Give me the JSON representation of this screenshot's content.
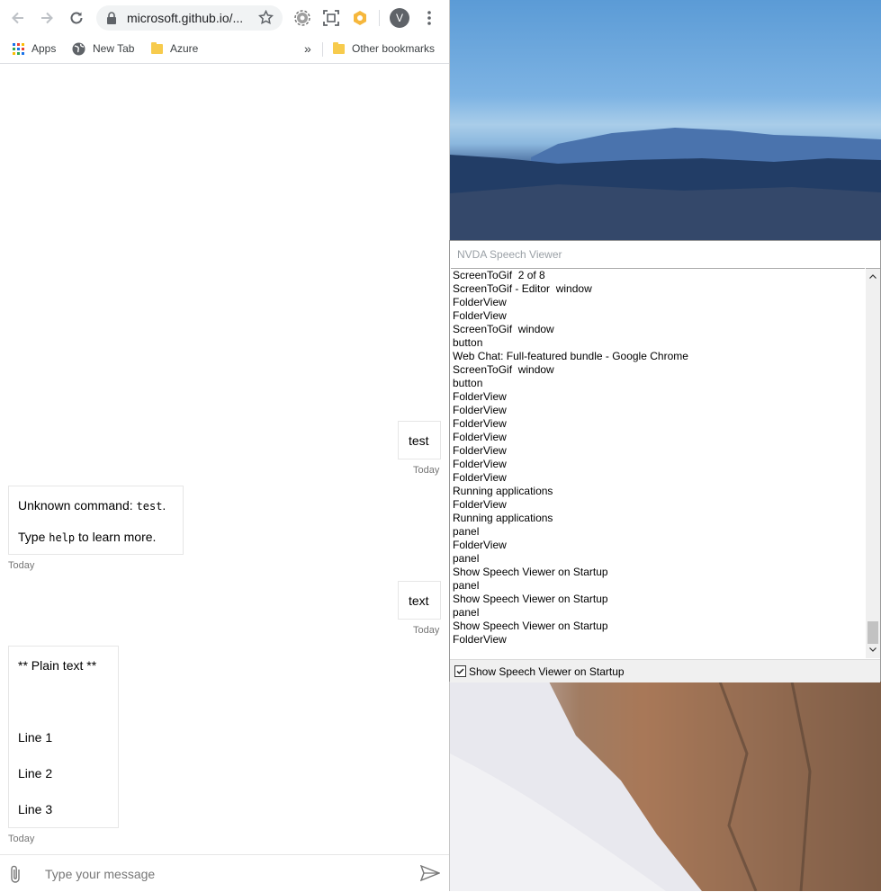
{
  "browser": {
    "url": "microsoft.github.io/...",
    "profile_initial": "V",
    "bookmarks": {
      "apps": "Apps",
      "new_tab": "New Tab",
      "azure": "Azure",
      "more": "»",
      "other": "Other bookmarks"
    }
  },
  "chat": {
    "messages": [
      {
        "from": "user",
        "text": "test",
        "timestamp": "Today"
      },
      {
        "from": "bot",
        "line1_pre": "Unknown command: ",
        "line1_code": "test",
        "line1_post": ".",
        "line2_pre": "Type ",
        "line2_code": "help",
        "line2_post": " to learn more.",
        "timestamp": "Today"
      },
      {
        "from": "user",
        "text": "text",
        "timestamp": "Today"
      },
      {
        "from": "bot",
        "lines": [
          "** Plain text **",
          "Line 1",
          "Line 2",
          "Line 3"
        ],
        "timestamp": "Today"
      }
    ],
    "input_placeholder": "Type your message"
  },
  "nvda": {
    "title": "NVDA Speech Viewer",
    "lines": [
      "ScreenToGif  2 of 8",
      "ScreenToGif - Editor  window",
      "FolderView",
      "FolderView",
      "ScreenToGif  window",
      "button",
      "Web Chat: Full-featured bundle - Google Chrome",
      "ScreenToGif  window",
      "button",
      "FolderView",
      "FolderView",
      "FolderView",
      "FolderView",
      "FolderView",
      "FolderView",
      "FolderView",
      "Running applications",
      "FolderView",
      "Running applications",
      "panel",
      "FolderView",
      "panel",
      "Show Speech Viewer on Startup",
      "panel",
      "Show Speech Viewer on Startup",
      "panel",
      "Show Speech Viewer on Startup",
      "FolderView"
    ],
    "checkbox_label": "Show Speech Viewer on Startup",
    "checkbox_checked": true
  }
}
